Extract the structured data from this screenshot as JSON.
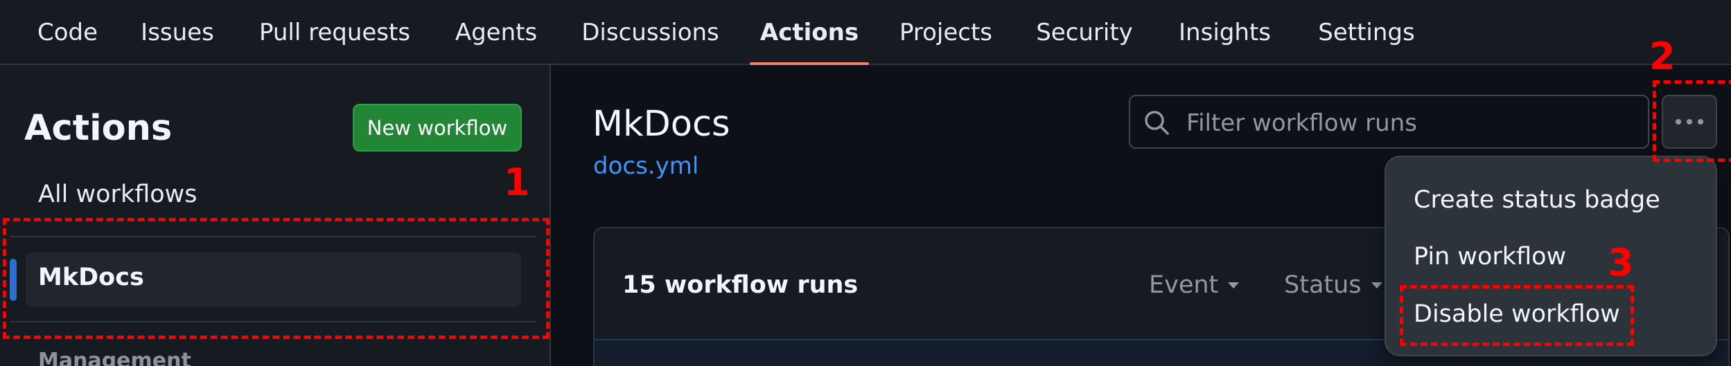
{
  "nav": {
    "items": [
      {
        "label": "Code"
      },
      {
        "label": "Issues"
      },
      {
        "label": "Pull requests"
      },
      {
        "label": "Agents"
      },
      {
        "label": "Discussions"
      },
      {
        "label": "Actions",
        "active": true
      },
      {
        "label": "Projects"
      },
      {
        "label": "Security"
      },
      {
        "label": "Insights"
      },
      {
        "label": "Settings"
      }
    ]
  },
  "sidebar": {
    "title": "Actions",
    "new_workflow_label": "New workflow",
    "all_workflows_label": "All workflows",
    "selected_workflow": "MkDocs",
    "management_label": "Management"
  },
  "main": {
    "title": "MkDocs",
    "file": "docs.yml",
    "filter_placeholder": "Filter workflow runs",
    "more_icon": "kebab-horizontal-icon",
    "runs_count": "15 workflow runs",
    "event_label": "Event",
    "status_label": "Status"
  },
  "menu": {
    "items": [
      {
        "label": "Create status badge"
      },
      {
        "label": "Pin workflow"
      },
      {
        "label": "Disable workflow"
      }
    ]
  },
  "annotations": {
    "step1": "1",
    "step2": "2",
    "step3": "3"
  },
  "colors": {
    "accent_underline": "#f78166",
    "primary_button": "#238636",
    "link": "#4493f8",
    "annotation": "#ff0000"
  }
}
